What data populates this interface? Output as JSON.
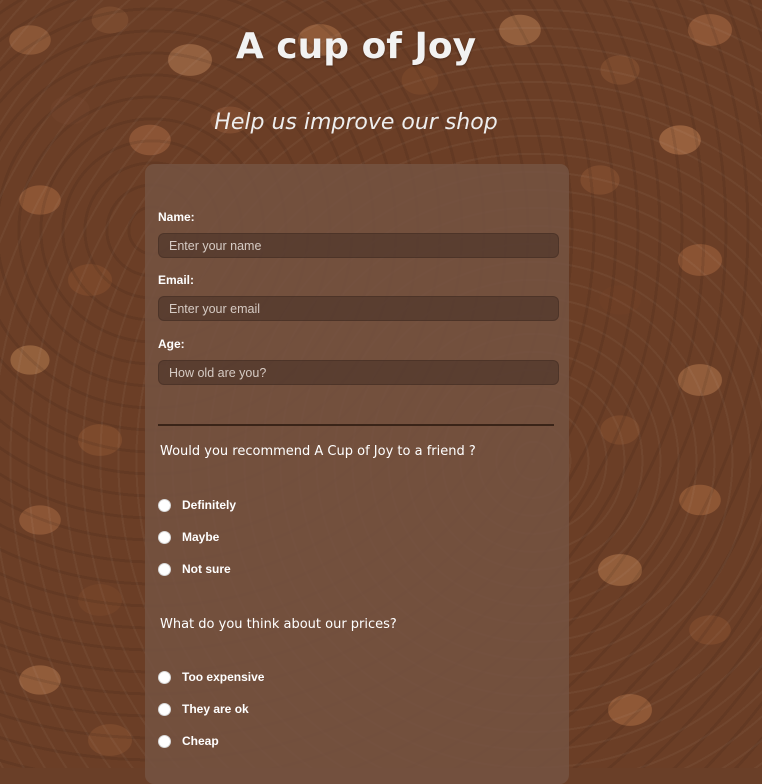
{
  "header": {
    "title": "A cup of Joy",
    "subtitle": "Help us improve our shop"
  },
  "form": {
    "name": {
      "label": "Name:",
      "placeholder": "Enter your name",
      "value": ""
    },
    "email": {
      "label": "Email:",
      "placeholder": "Enter your email",
      "value": ""
    },
    "age": {
      "label": "Age:",
      "placeholder": "How old are you?",
      "value": ""
    },
    "q1": {
      "question": "Would you recommend A Cup of Joy to a friend ?",
      "options": [
        "Definitely",
        "Maybe",
        "Not sure"
      ]
    },
    "q2": {
      "question": "What do you think about our prices?",
      "options": [
        "Too expensive",
        "They are ok",
        "Cheap"
      ]
    }
  },
  "colors": {
    "card": "#755443",
    "text": "#ffffff",
    "divider": "#3a2418"
  }
}
